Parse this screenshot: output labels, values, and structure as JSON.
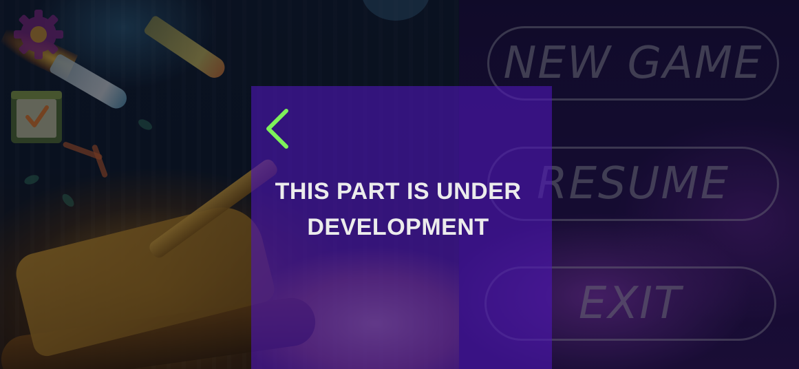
{
  "menu": {
    "new_game_label": "NEW GAME",
    "resume_label": "RESUME",
    "exit_label": "EXIT"
  },
  "modal": {
    "message_line_1": "THIS PART IS UNDER",
    "message_line_2": "DEVELOPMENT",
    "back_icon": "chevron-left-icon"
  },
  "icons": {
    "settings": "gear-icon",
    "daily": "calendar-check-icon"
  },
  "colors": {
    "modal_bg": "#4e16b4",
    "back_chevron": "#7ef15a",
    "message_text": "#ececec",
    "menu_outline": "#c8c8d2"
  }
}
